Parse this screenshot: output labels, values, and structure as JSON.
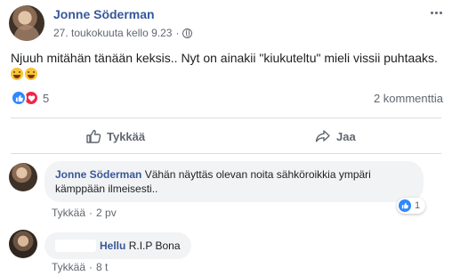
{
  "post": {
    "author": "Jonne Söderman",
    "timestamp": "27. toukokuuta kello 9.23",
    "privacy_icon": "globe-icon",
    "text": "Njuuh mitähän tänään keksis.. Nyt on ainakii \"kiukuteltu\" mieli vissii puhtaaks.",
    "emojis": [
      "laughing-emoji",
      "grinning-emoji"
    ],
    "reaction_types": [
      "like",
      "love"
    ],
    "reaction_count": "5",
    "comments_count": "2 kommenttia"
  },
  "actions": {
    "like_label": "Tykkää",
    "share_label": "Jaa"
  },
  "comments": [
    {
      "author": "Jonne Söderman",
      "text": "Vähän näyttäs olevan noita sähköroikkia ympäri kämppään ilmeisesti..",
      "like_label": "Tykkää",
      "separator": "·",
      "time": "2 pv",
      "reaction_count": "1"
    },
    {
      "author": "Hellu",
      "text": "R.I.P Bona",
      "like_label": "Tykkää",
      "separator": "·",
      "time": "8 t"
    }
  ],
  "colors": {
    "link": "#365899",
    "secondary_text": "#606770",
    "bubble": "#f2f3f5",
    "like_blue": "#2d88ff",
    "love_red": "#f0284a"
  }
}
